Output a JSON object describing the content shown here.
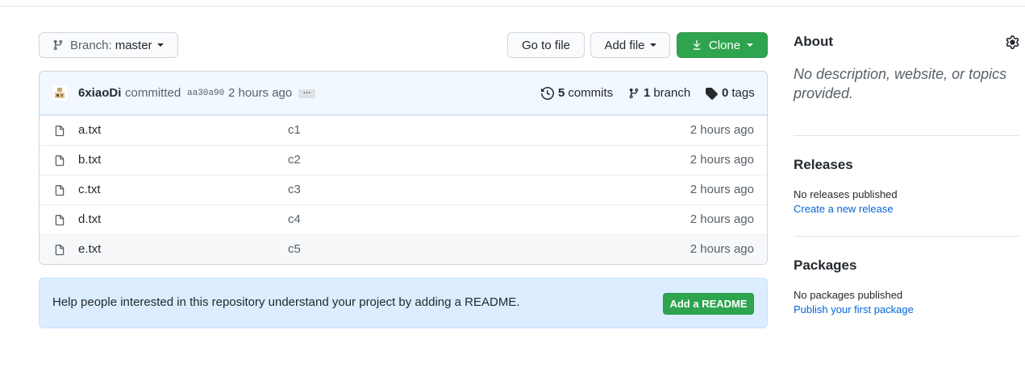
{
  "toolbar": {
    "branch_prefix": "Branch:",
    "branch_name": "master",
    "go_to_file": "Go to file",
    "add_file": "Add file",
    "clone": "Clone"
  },
  "commit": {
    "author": "6xiaoDi",
    "verb": "committed",
    "sha": "aa30a90",
    "time": "2 hours ago",
    "ellipsis": "…",
    "commits_count": "5",
    "commits_label": "commits",
    "branch_count": "1",
    "branch_label": "branch",
    "tags_count": "0",
    "tags_label": "tags"
  },
  "files": [
    {
      "name": "a.txt",
      "message": "c1",
      "age": "2 hours ago"
    },
    {
      "name": "b.txt",
      "message": "c2",
      "age": "2 hours ago"
    },
    {
      "name": "c.txt",
      "message": "c3",
      "age": "2 hours ago"
    },
    {
      "name": "d.txt",
      "message": "c4",
      "age": "2 hours ago"
    },
    {
      "name": "e.txt",
      "message": "c5",
      "age": "2 hours ago"
    }
  ],
  "readme": {
    "text": "Help people interested in this repository understand your project by adding a README.",
    "button": "Add a README"
  },
  "sidebar": {
    "about_title": "About",
    "about_desc": "No description, website, or topics provided.",
    "releases_title": "Releases",
    "releases_empty": "No releases published",
    "releases_link": "Create a new release",
    "packages_title": "Packages",
    "packages_empty": "No packages published",
    "packages_link": "Publish your first package"
  },
  "colors": {
    "accent_green": "#2ea44f",
    "link_blue": "#0366d6",
    "commit_bar": "#f1f8ff",
    "readme_bg": "#dbedff"
  },
  "icons": [
    "git-branch-icon",
    "caret-down-icon",
    "download-icon",
    "history-icon",
    "tag-icon",
    "file-icon",
    "gear-icon",
    "avatar"
  ]
}
